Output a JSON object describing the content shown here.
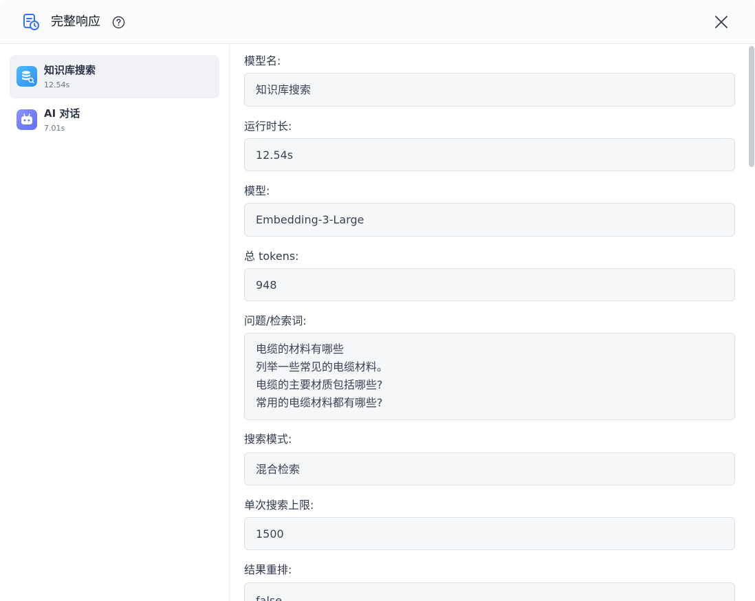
{
  "header": {
    "title": "完整响应",
    "logo_icon": "response-log-icon",
    "help_icon": "help-circle-icon",
    "close_icon": "close-icon"
  },
  "sidebar": {
    "items": [
      {
        "name": "知识库搜索",
        "time": "12.54s",
        "icon": "dataset-search-icon",
        "icon_color": "#3aa0f5",
        "active": true
      },
      {
        "name": "AI 对话",
        "time": "7.01s",
        "icon": "ai-bot-icon",
        "icon_color": "#6d7cf7",
        "active": false
      }
    ]
  },
  "fields": {
    "module_name": {
      "label": "模型名:",
      "value": "知识库搜索"
    },
    "run_time": {
      "label": "运行时长:",
      "value": "12.54s"
    },
    "model": {
      "label": "模型:",
      "value": "Embedding-3-Large"
    },
    "total_tokens": {
      "label": "总 tokens:",
      "value": "948"
    },
    "query": {
      "label": "问题/检索词:",
      "lines": [
        "电缆的材料有哪些",
        "列举一些常见的电缆材料。",
        "电缆的主要材质包括哪些?",
        "常用的电缆材料都有哪些?"
      ]
    },
    "search_mode": {
      "label": "搜索模式:",
      "value": "混合检索"
    },
    "search_limit": {
      "label": "单次搜索上限:",
      "value": "1500"
    },
    "rerank": {
      "label": "结果重排:",
      "value": "false"
    }
  },
  "colors": {
    "accent": "#3370ff",
    "field_bg": "#f6f7f9",
    "active_item_bg": "#f1f2f5"
  }
}
